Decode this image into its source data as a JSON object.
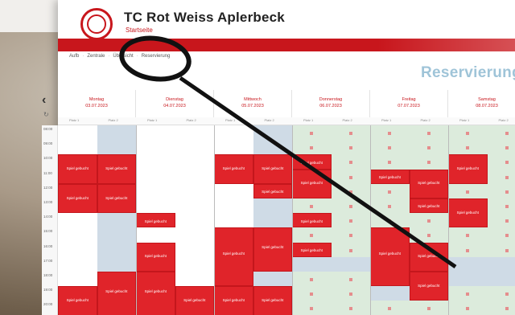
{
  "club": {
    "name": "TC Rot Weiss Aplerbeck",
    "back_link": "Startseite"
  },
  "breadcrumb": [
    "Aufb",
    "Zentrale",
    "Übersicht",
    "Reservierung"
  ],
  "page": {
    "heading": "Reservierung"
  },
  "calendar": {
    "days": [
      {
        "name": "Montag",
        "date": "03.07.2023"
      },
      {
        "name": "Dienstag",
        "date": "04.07.2023"
      },
      {
        "name": "Mittwoch",
        "date": "05.07.2023"
      },
      {
        "name": "Donnerstag",
        "date": "06.07.2023"
      },
      {
        "name": "Freitag",
        "date": "07.07.2023"
      },
      {
        "name": "Samstag",
        "date": "08.07.2023"
      }
    ],
    "court_labels": [
      "Platz 1",
      "Platz 2"
    ],
    "times": [
      "08:00",
      "09:00",
      "10:00",
      "11:00",
      "12:00",
      "13:00",
      "14:00",
      "15:00",
      "16:00",
      "17:00",
      "18:00",
      "19:00",
      "20:00"
    ],
    "booking_label": "Spiel",
    "booking_sublabel": "gebucht"
  },
  "colors": {
    "accent": "#c8161c",
    "booked": "#e0242a",
    "free": "#dcebdc",
    "heading": "#9fc4d8"
  },
  "icons": {
    "back": "chevron-left",
    "refresh": "refresh"
  }
}
